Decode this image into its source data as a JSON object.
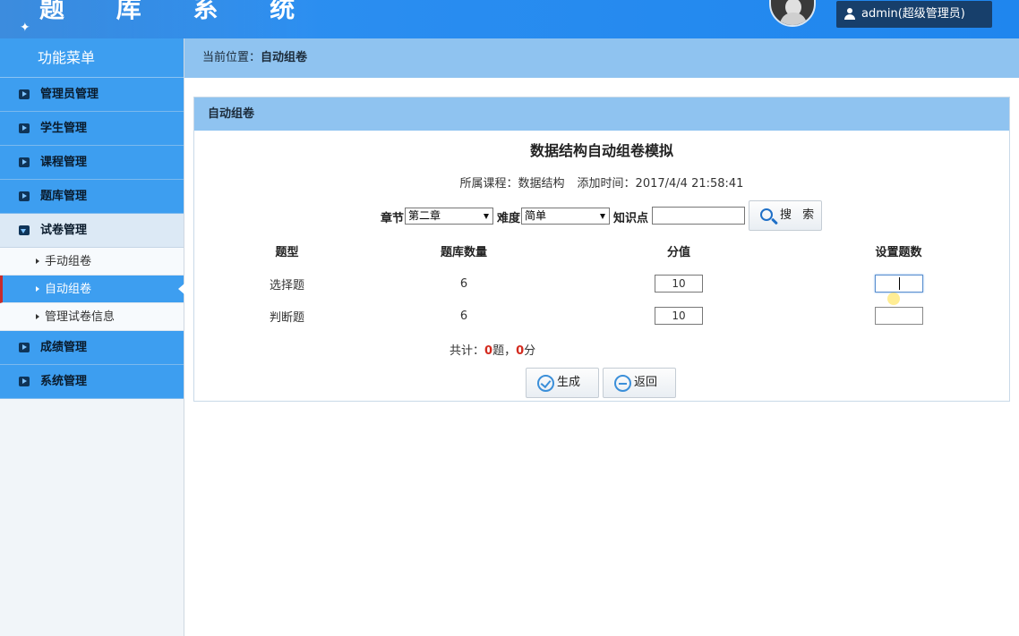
{
  "header": {
    "logo_text": "题 库 系 统",
    "user_label": "admin(超级管理员)"
  },
  "sidebar": {
    "title": "功能菜单",
    "items": [
      {
        "label": "管理员管理"
      },
      {
        "label": "学生管理"
      },
      {
        "label": "课程管理"
      },
      {
        "label": "题库管理"
      },
      {
        "label": "试卷管理",
        "open": true,
        "children": [
          {
            "label": "手动组卷"
          },
          {
            "label": "自动组卷",
            "active": true
          },
          {
            "label": "管理试卷信息"
          }
        ]
      },
      {
        "label": "成绩管理"
      },
      {
        "label": "系统管理"
      }
    ]
  },
  "breadcrumb": {
    "prefix": "当前位置：",
    "current": "自动组卷"
  },
  "panel": {
    "heading": "自动组卷",
    "paper_title": "数据结构自动组卷模拟",
    "course": "所属课程：数据结构",
    "added_time": "添加时间：2017/4/4 21:58:41",
    "filter": {
      "chapter_label": "章节",
      "chapter_value": "第二章",
      "difficulty_label": "难度",
      "difficulty_value": "简单",
      "knowledge_label": "知识点",
      "knowledge_value": "",
      "search_label": "搜 索"
    },
    "table": {
      "headers": [
        "题型",
        "题库数量",
        "分值",
        "设置题数"
      ],
      "rows": [
        {
          "type": "选择题",
          "count": "6",
          "score": "10",
          "set": ""
        },
        {
          "type": "判断题",
          "count": "6",
          "score": "10",
          "set": ""
        }
      ]
    },
    "summary": {
      "prefix": "共计：",
      "questions": "0",
      "q_unit": "题，",
      "points": "0",
      "p_unit": "分"
    },
    "generate_label": "生成",
    "back_label": "返回"
  }
}
